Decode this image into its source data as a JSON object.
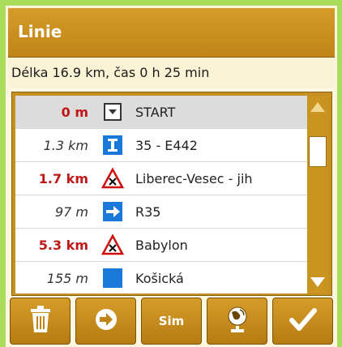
{
  "header": {
    "title": "Linie"
  },
  "summary": {
    "text": "Délka 16.9 km, čas 0 h 25 min"
  },
  "rows": [
    {
      "distance": "0 m",
      "label": "START",
      "icon": "down-arrow-box-icon",
      "style": "red",
      "selected": true
    },
    {
      "distance": "1.3 km",
      "label": "35 - E442",
      "icon": "highway-icon",
      "style": "gray"
    },
    {
      "distance": "1.7 km",
      "label": "Liberec-Vesec - jih",
      "icon": "warning-triangle-icon",
      "style": "red"
    },
    {
      "distance": "97 m",
      "label": "R35",
      "icon": "right-arrow-icon",
      "style": "gray"
    },
    {
      "distance": "5.3 km",
      "label": "Babylon",
      "icon": "warning-triangle-icon",
      "style": "red"
    },
    {
      "distance": "155 m",
      "label": "Košická",
      "icon": "blue-square-icon",
      "style": "gray"
    }
  ],
  "toolbar": {
    "buttons": [
      {
        "name": "delete",
        "icon": "trash-icon"
      },
      {
        "name": "navigate",
        "icon": "arrow-circle-icon"
      },
      {
        "name": "sim",
        "label": "Sim"
      },
      {
        "name": "map",
        "icon": "globe-icon"
      },
      {
        "name": "confirm",
        "icon": "check-icon"
      }
    ]
  },
  "colors": {
    "accent": "#c58a1a",
    "red_distance": "#c01818",
    "blue_icon": "#1a78d8"
  }
}
